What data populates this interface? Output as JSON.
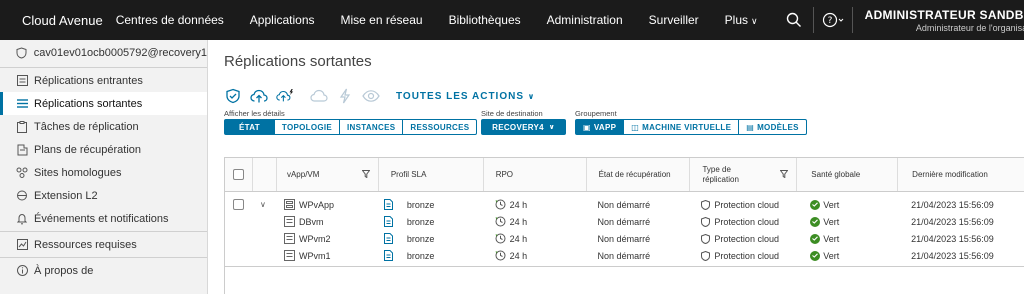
{
  "header": {
    "app_title": "Cloud Avenue",
    "nav": [
      "Centres de données",
      "Applications",
      "Mise en réseau",
      "Bibliothèques",
      "Administration",
      "Surveiller",
      "Plus"
    ],
    "user_name": "ADMINISTRATEUR SANDBOX",
    "user_role": "Administrateur de l'organisation"
  },
  "sidebar": {
    "items": [
      {
        "label": "cav01ev01ocb0005792@recovery1",
        "icon": "shield-icon"
      },
      {
        "label": "Réplications entrantes",
        "icon": "list-icon"
      },
      {
        "label": "Réplications sortantes",
        "icon": "list-icon",
        "active": true
      },
      {
        "label": "Tâches de réplication",
        "icon": "clipboard-icon"
      },
      {
        "label": "Plans de récupération",
        "icon": "plan-icon"
      },
      {
        "label": "Sites homologues",
        "icon": "sites-icon"
      },
      {
        "label": "Extension L2",
        "icon": "network-icon"
      },
      {
        "label": "Événements et notifications",
        "icon": "bell-icon"
      },
      {
        "label": "Ressources requises",
        "icon": "resources-icon"
      },
      {
        "label": "À propos de",
        "icon": "info-icon"
      }
    ]
  },
  "main": {
    "title": "Réplications sortantes",
    "actions_label": "TOUTES LES ACTIONS",
    "details_label": "Afficher les détails",
    "details_tabs": [
      "ÉTAT",
      "TOPOLOGIE",
      "INSTANCES",
      "RESSOURCES"
    ],
    "site_label": "Site de destination",
    "site_value": "RECOVERY4",
    "grouping_label": "Groupement",
    "grouping_tabs": [
      "VAPP",
      "MACHINE VIRTUELLE",
      "MODÈLES"
    ]
  },
  "grid": {
    "columns": [
      "vApp/VM",
      "Profil SLA",
      "RPO",
      "État de récupération",
      "Type de réplication",
      "Santé globale",
      "Dernière modification"
    ],
    "rows": [
      {
        "name": "WPvApp",
        "sla": "bronze",
        "rpo": "24 h",
        "state": "Non démarré",
        "type": "Protection cloud",
        "health": "Vert",
        "modified": "21/04/2023 15:56:09"
      },
      {
        "name": "DBvm",
        "sla": "bronze",
        "rpo": "24 h",
        "state": "Non démarré",
        "type": "Protection cloud",
        "health": "Vert",
        "modified": "21/04/2023 15:56:09"
      },
      {
        "name": "WPvm2",
        "sla": "bronze",
        "rpo": "24 h",
        "state": "Non démarré",
        "type": "Protection cloud",
        "health": "Vert",
        "modified": "21/04/2023 15:56:09"
      },
      {
        "name": "WPvm1",
        "sla": "bronze",
        "rpo": "24 h",
        "state": "Non démarré",
        "type": "Protection cloud",
        "health": "Vert",
        "modified": "21/04/2023 15:56:09"
      }
    ]
  },
  "colors": {
    "accent": "#0072a3",
    "brand": "#ff7900",
    "topbar": "#1b1b1b",
    "ok": "#3c8d23"
  }
}
